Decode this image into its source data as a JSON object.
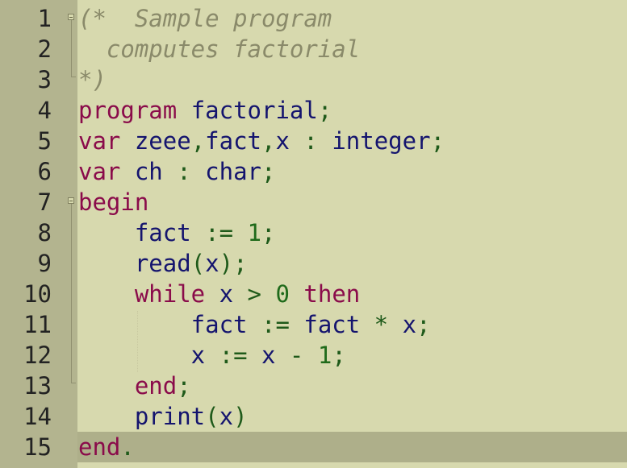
{
  "line_numbers": [
    "1",
    "2",
    "3",
    "4",
    "5",
    "6",
    "7",
    "8",
    "9",
    "10",
    "11",
    "12",
    "13",
    "14",
    "15"
  ],
  "lines": [
    [
      {
        "t": "(*  Sample program",
        "c": "cmt"
      }
    ],
    [
      {
        "t": "  computes factorial",
        "c": "cmt"
      }
    ],
    [
      {
        "t": "*)",
        "c": "cmt"
      }
    ],
    [
      {
        "t": "program",
        "c": "kw"
      },
      {
        "t": " ",
        "c": "id"
      },
      {
        "t": "factorial",
        "c": "id"
      },
      {
        "t": ";",
        "c": "pun"
      }
    ],
    [
      {
        "t": "var",
        "c": "kw"
      },
      {
        "t": " zeee",
        "c": "id"
      },
      {
        "t": ",",
        "c": "pun"
      },
      {
        "t": "fact",
        "c": "id"
      },
      {
        "t": ",",
        "c": "pun"
      },
      {
        "t": "x ",
        "c": "id"
      },
      {
        "t": ":",
        "c": "op"
      },
      {
        "t": " integer",
        "c": "id"
      },
      {
        "t": ";",
        "c": "pun"
      }
    ],
    [
      {
        "t": "var",
        "c": "kw"
      },
      {
        "t": " ch ",
        "c": "id"
      },
      {
        "t": ":",
        "c": "op"
      },
      {
        "t": " char",
        "c": "id"
      },
      {
        "t": ";",
        "c": "pun"
      }
    ],
    [
      {
        "t": "begin",
        "c": "kw"
      }
    ],
    [
      {
        "t": "    fact ",
        "c": "id"
      },
      {
        "t": ":=",
        "c": "op"
      },
      {
        "t": " ",
        "c": "id"
      },
      {
        "t": "1",
        "c": "num"
      },
      {
        "t": ";",
        "c": "pun"
      }
    ],
    [
      {
        "t": "    read",
        "c": "id"
      },
      {
        "t": "(",
        "c": "pun"
      },
      {
        "t": "x",
        "c": "id"
      },
      {
        "t": ");",
        "c": "pun"
      }
    ],
    [
      {
        "t": "    ",
        "c": "id"
      },
      {
        "t": "while",
        "c": "kw"
      },
      {
        "t": " x ",
        "c": "id"
      },
      {
        "t": ">",
        "c": "op"
      },
      {
        "t": " ",
        "c": "id"
      },
      {
        "t": "0",
        "c": "num"
      },
      {
        "t": " ",
        "c": "id"
      },
      {
        "t": "then",
        "c": "kw"
      }
    ],
    [
      {
        "t": "        fact ",
        "c": "id"
      },
      {
        "t": ":=",
        "c": "op"
      },
      {
        "t": " fact ",
        "c": "id"
      },
      {
        "t": "*",
        "c": "op"
      },
      {
        "t": " x",
        "c": "id"
      },
      {
        "t": ";",
        "c": "pun"
      }
    ],
    [
      {
        "t": "        x ",
        "c": "id"
      },
      {
        "t": ":=",
        "c": "op"
      },
      {
        "t": " x ",
        "c": "id"
      },
      {
        "t": "-",
        "c": "op"
      },
      {
        "t": " ",
        "c": "id"
      },
      {
        "t": "1",
        "c": "num"
      },
      {
        "t": ";",
        "c": "pun"
      }
    ],
    [
      {
        "t": "    ",
        "c": "id"
      },
      {
        "t": "end",
        "c": "kw"
      },
      {
        "t": ";",
        "c": "pun"
      }
    ],
    [
      {
        "t": "    print",
        "c": "id"
      },
      {
        "t": "(",
        "c": "pun"
      },
      {
        "t": "x",
        "c": "id"
      },
      {
        "t": ")",
        "c": "pun"
      }
    ],
    [
      {
        "t": "end",
        "c": "kw"
      },
      {
        "t": ".",
        "c": "pun"
      }
    ]
  ],
  "current_line": 15
}
